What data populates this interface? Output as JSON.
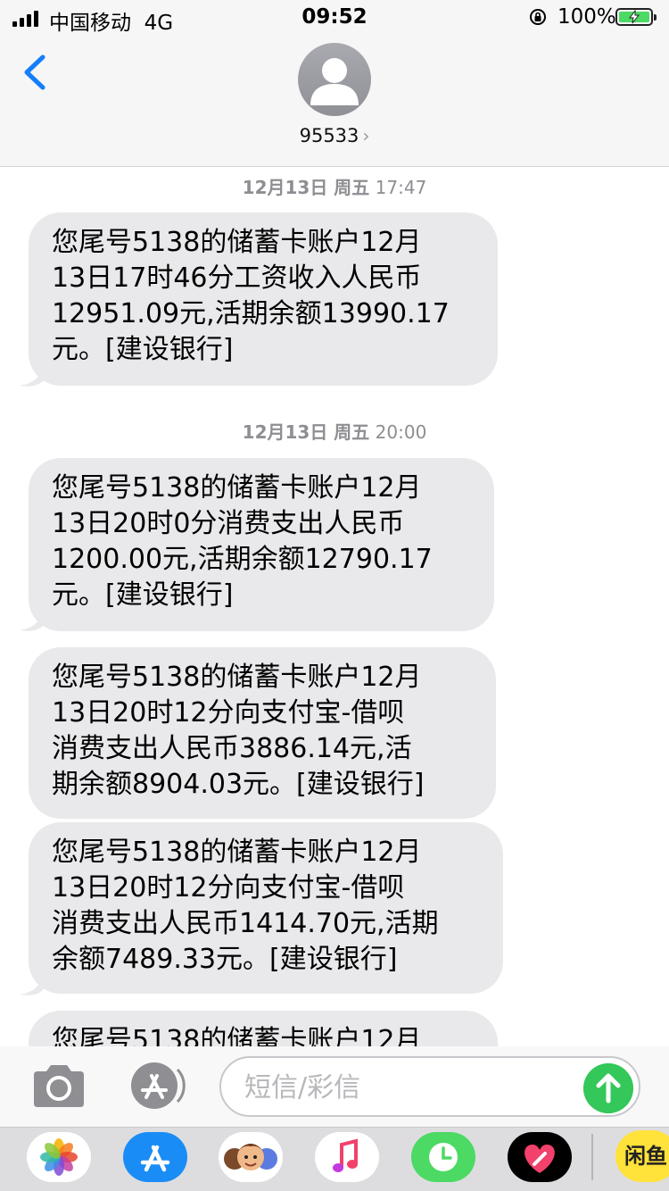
{
  "status_bar": {
    "carrier": "中国移动",
    "network": "4G",
    "time": "09:52",
    "battery_percent": "100%",
    "battery_level": 1.0,
    "charging": true
  },
  "header": {
    "contact": "95533",
    "contact_chevron": "›"
  },
  "messages": [
    {
      "timestamp_date": "12月13日 周五",
      "timestamp_time": "17:47",
      "text": "您尾号5138的储蓄卡账户12月\n13日17时46分工资收入人民币\n12951.09元,活期余额13990.17\n元。[建设银行]"
    },
    {
      "timestamp_date": "12月13日 周五",
      "timestamp_time": "20:00",
      "text": "您尾号5138的储蓄卡账户12月\n13日20时0分消费支出人民币\n1200.00元,活期余额12790.17\n元。[建设银行]"
    },
    {
      "text": "您尾号5138的储蓄卡账户12月\n13日20时12分向支付宝-借呗\n消费支出人民币3886.14元,活\n期余额8904.03元。[建设银行]"
    },
    {
      "text": "您尾号5138的储蓄卡账户12月\n13日20时12分向支付宝-借呗\n消费支出人民币1414.70元,活期\n余额7489.33元。[建设银行]"
    },
    {
      "text": "您尾号5138的储蓄卡账户12月"
    }
  ],
  "input": {
    "placeholder": "短信/彩信"
  },
  "app_strip": {
    "icons": [
      "photos-icon",
      "app-store-icon",
      "memoji-icon",
      "music-icon",
      "clock-icon",
      "heart-app-icon"
    ],
    "last_label": "闲鱼"
  },
  "colors": {
    "bubble": "#e9e9eb",
    "accent_blue": "#147efb",
    "send_green": "#34c759"
  }
}
